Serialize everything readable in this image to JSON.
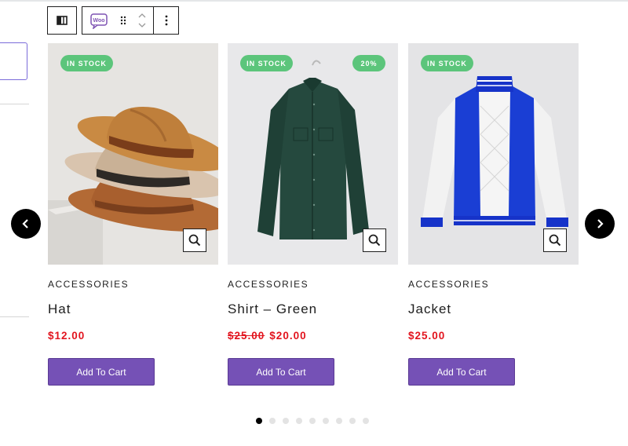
{
  "toolbar": {
    "layout_icon": "columns-icon",
    "woo_icon_text": "Woo",
    "drag_icon": "drag-handle-icon",
    "move_up_icon": "chevron-up-icon",
    "move_down_icon": "chevron-down-icon",
    "more_icon": "more-vertical-icon"
  },
  "products": [
    {
      "badge": "IN STOCK",
      "sale_badge": "",
      "image": "hat-photo",
      "category": "ACCESSORIES",
      "title": "Hat",
      "old_price": "",
      "price": "$12.00",
      "button": "Add To Cart"
    },
    {
      "badge": "IN STOCK",
      "sale_badge": "20%",
      "image": "shirt-photo",
      "category": "ACCESSORIES",
      "title": "Shirt – Green",
      "old_price": "$25.00",
      "price": "$20.00",
      "button": "Add To Cart"
    },
    {
      "badge": "IN STOCK",
      "sale_badge": "",
      "image": "jacket-photo",
      "category": "ACCESSORIES",
      "title": "Jacket",
      "old_price": "",
      "price": "$25.00",
      "button": "Add To Cart"
    }
  ],
  "carousel": {
    "prev_icon": "chevron-left-icon",
    "next_icon": "chevron-right-icon",
    "pages": 9,
    "active_page": 1
  },
  "colors": {
    "badge": "#5cc57b",
    "price": "#e2141e",
    "button": "#7551b6",
    "nav": "#000000"
  }
}
